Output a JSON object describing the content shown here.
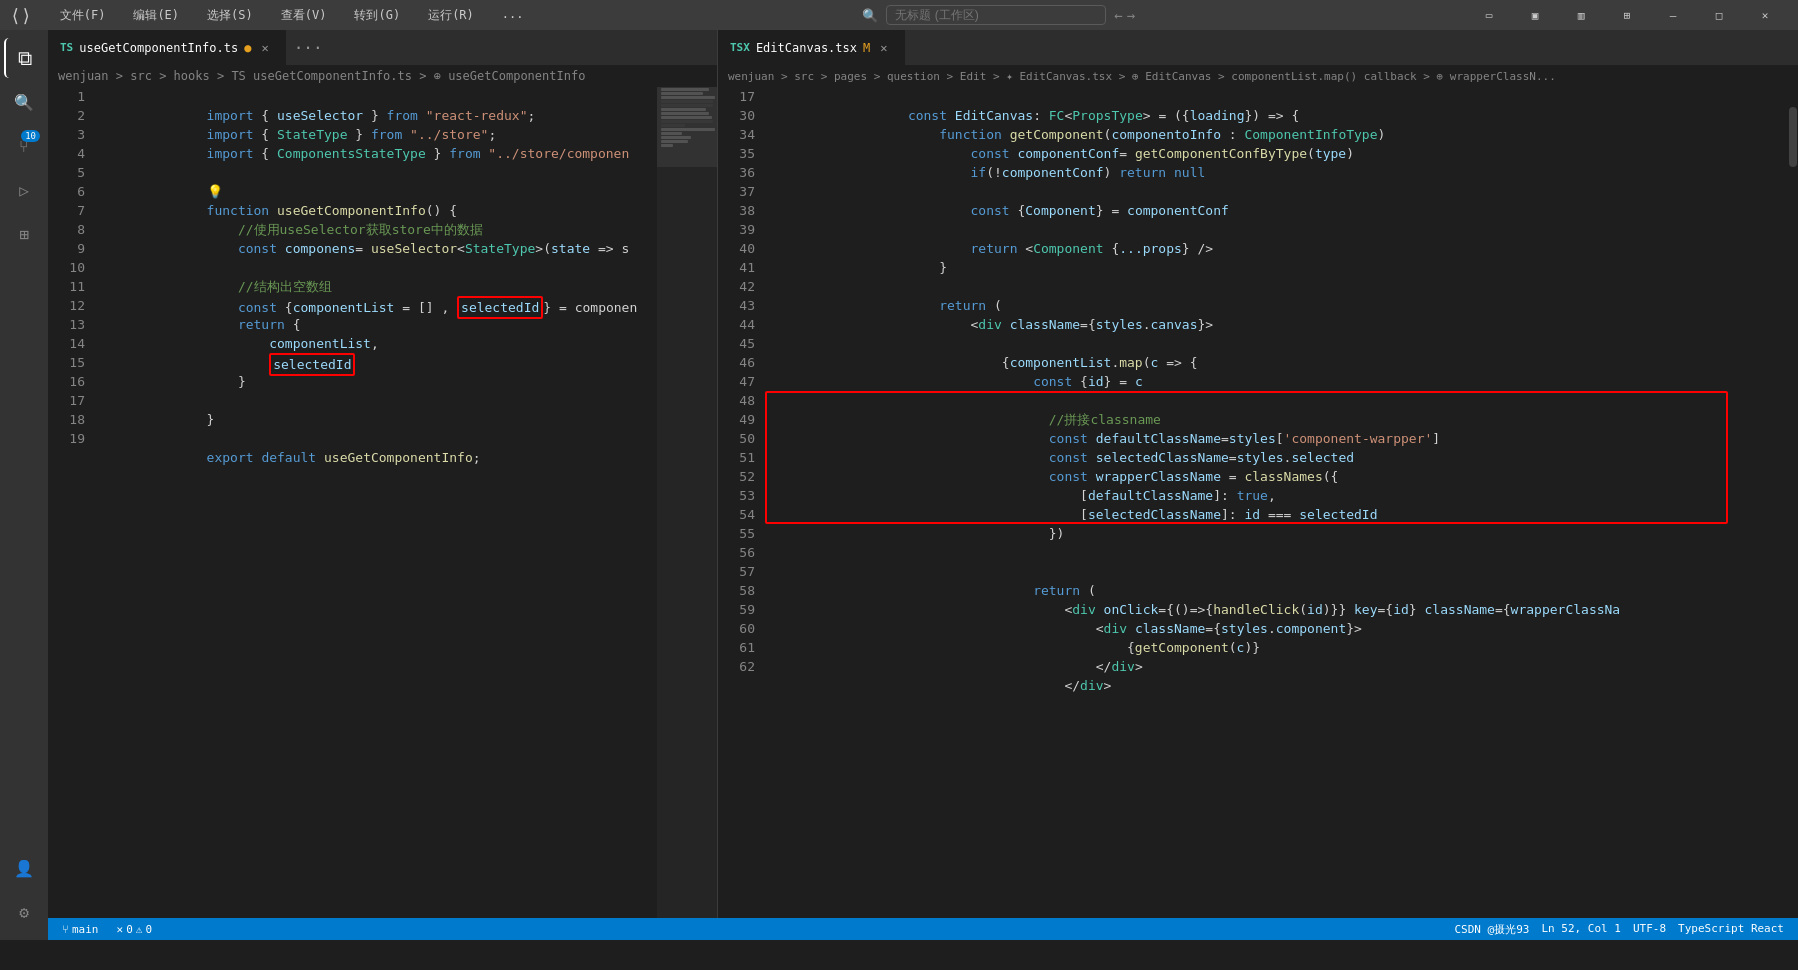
{
  "titleBar": {
    "menuItems": [
      "文件(F)",
      "编辑(E)",
      "选择(S)",
      "查看(V)",
      "转到(G)",
      "运行(R)",
      "..."
    ],
    "searchPlaceholder": "无标题 (工作区)",
    "winControls": [
      "▭",
      "❐",
      "✕"
    ]
  },
  "leftEditor": {
    "tab": {
      "label": "useGetComponentInfo.ts",
      "type": "TS",
      "modified": true
    },
    "breadcrumb": "wenjuan > src > hooks > TS useGetComponentInfo.ts > ⊕ useGetComponentInfo",
    "lines": [
      {
        "num": 1,
        "content": "import { useSelector } from \"react-redux\";"
      },
      {
        "num": 2,
        "content": "import { StateType } from \"../store\";"
      },
      {
        "num": 3,
        "content": "import { ComponentsStateType } from \"../store/componen"
      },
      {
        "num": 4,
        "content": ""
      },
      {
        "num": 5,
        "content": ""
      },
      {
        "num": 6,
        "content": "function useGetComponentInfo() {"
      },
      {
        "num": 7,
        "content": "    //使用useSelector获取store中的数据"
      },
      {
        "num": 8,
        "content": "    const componens= useSelector<StateType>(state => s"
      },
      {
        "num": 9,
        "content": ""
      },
      {
        "num": 10,
        "content": "    //结构出空数组"
      },
      {
        "num": 11,
        "content": "    const {componentList = [] , selectedId} = componen"
      },
      {
        "num": 12,
        "content": "    return {"
      },
      {
        "num": 13,
        "content": "        componentList,"
      },
      {
        "num": 14,
        "content": "        selectedId"
      },
      {
        "num": 15,
        "content": "    }"
      },
      {
        "num": 16,
        "content": ""
      },
      {
        "num": 17,
        "content": "}"
      },
      {
        "num": 18,
        "content": ""
      },
      {
        "num": 19,
        "content": "export default useGetComponentInfo;"
      }
    ]
  },
  "rightEditor": {
    "tab": {
      "label": "EditCanvas.tsx",
      "type": "TSX",
      "modified": true
    },
    "breadcrumb": "wenjuan > src > pages > question > Edit > ✦ EditCanvas.tsx > ⊕ EditCanvas > componentList.map() callback > ⊕ wrapperClassN...",
    "lines": [
      {
        "num": 17,
        "content": "    const EditCanvas: FC<PropsType> = ({loading}) => {"
      },
      {
        "num": 30,
        "content": "        function getComponent(componentoInfo : ComponentInfoType)"
      },
      {
        "num": 34,
        "content": "            const componentConf= getComponentConfByType(type)"
      },
      {
        "num": 35,
        "content": "            if(!componentConf) return null"
      },
      {
        "num": 36,
        "content": ""
      },
      {
        "num": 37,
        "content": "            const {Component} = componentConf"
      },
      {
        "num": 38,
        "content": ""
      },
      {
        "num": 39,
        "content": "            return <Component {...props} />"
      },
      {
        "num": 40,
        "content": "        }"
      },
      {
        "num": 41,
        "content": ""
      },
      {
        "num": 42,
        "content": "        return ("
      },
      {
        "num": 43,
        "content": "            <div className={styles.canvas}>"
      },
      {
        "num": 44,
        "content": ""
      },
      {
        "num": 45,
        "content": "                {componentList.map(c => {"
      },
      {
        "num": 46,
        "content": "                    const {id} = c"
      },
      {
        "num": 47,
        "content": ""
      },
      {
        "num": 48,
        "content": "                    //拼接classname"
      },
      {
        "num": 49,
        "content": "                    const defaultClassName=styles['component-warpper']"
      },
      {
        "num": 50,
        "content": "                    const selectedClassName=styles.selected"
      },
      {
        "num": 51,
        "content": "                    const wrapperClassName = classNames({"
      },
      {
        "num": 52,
        "content": "                        [defaultClassName]: true,"
      },
      {
        "num": 53,
        "content": "                        [selectedClassName]: id === selectedId"
      },
      {
        "num": 54,
        "content": "                    })"
      },
      {
        "num": 55,
        "content": ""
      },
      {
        "num": 56,
        "content": ""
      },
      {
        "num": 57,
        "content": "                    return ("
      },
      {
        "num": 58,
        "content": "                        <div onClick={()=>{handleClick(id)}} key={id} className={wrapperClassNa"
      },
      {
        "num": 59,
        "content": "                            <div className={styles.component}>"
      },
      {
        "num": 60,
        "content": "                                {getComponent(c)}"
      },
      {
        "num": 61,
        "content": "                            </div>"
      },
      {
        "num": 62,
        "content": "                        </div>"
      }
    ]
  },
  "statusBar": {
    "branch": "main",
    "errors": "0",
    "warnings": "0",
    "rightItems": [
      "CSDN @摄光93",
      "Ln 52, Col 1",
      "UTF-8",
      "TypeScript React"
    ]
  },
  "activityBar": {
    "icons": [
      {
        "name": "files-icon",
        "symbol": "⧉",
        "active": true
      },
      {
        "name": "search-icon",
        "symbol": "🔍"
      },
      {
        "name": "source-control-icon",
        "symbol": "⑂",
        "badge": "10"
      },
      {
        "name": "run-icon",
        "symbol": "▶"
      },
      {
        "name": "extensions-icon",
        "symbol": "⊞"
      }
    ],
    "bottomIcons": [
      {
        "name": "account-icon",
        "symbol": "👤"
      },
      {
        "name": "settings-icon",
        "symbol": "⚙"
      }
    ]
  }
}
